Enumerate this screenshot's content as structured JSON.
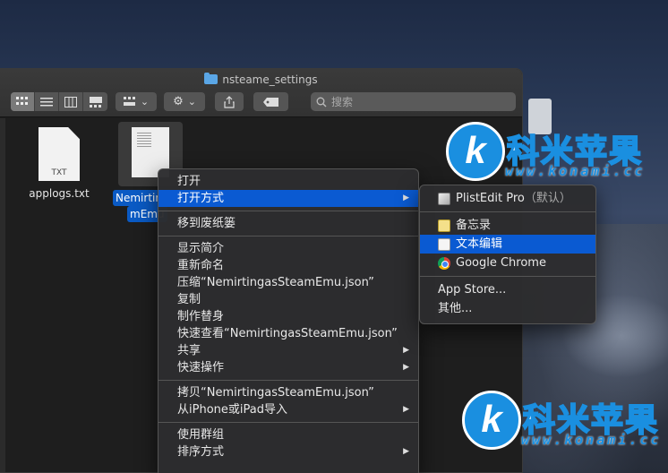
{
  "window": {
    "title": "nsteame_settings",
    "search_placeholder": "搜索"
  },
  "files": [
    {
      "name": "applogs.txt",
      "ext": "TXT"
    },
    {
      "name_line1": "Nemirtin",
      "name_line2": "mEmu"
    }
  ],
  "context_menu": {
    "items": [
      {
        "label": "打开"
      },
      {
        "label": "打开方式"
      },
      {
        "label": "移到废纸篓"
      },
      {
        "label": "显示简介"
      },
      {
        "label": "重新命名"
      },
      {
        "label": "压缩“NemirtingasSteamEmu.json”"
      },
      {
        "label": "复制"
      },
      {
        "label": "制作替身"
      },
      {
        "label": "快速查看“NemirtingasSteamEmu.json”"
      },
      {
        "label": "共享"
      },
      {
        "label": "快速操作"
      },
      {
        "label": "拷贝“NemirtingasSteamEmu.json”"
      },
      {
        "label": "从iPhone或iPad导入"
      },
      {
        "label": "使用群组"
      },
      {
        "label": "排序方式"
      }
    ]
  },
  "open_with_submenu": {
    "default_app": "PlistEdit Pro",
    "default_suffix": "（默认）",
    "apps": [
      "备忘录",
      "文本编辑",
      "Google Chrome"
    ],
    "app_store": "App Store...",
    "other": "其他..."
  },
  "watermark": {
    "title": "科米苹果",
    "url": "www.konami.cc"
  },
  "colors": {
    "accent": "#0a5ad2",
    "watermark_blue": "#1a8fe0"
  }
}
